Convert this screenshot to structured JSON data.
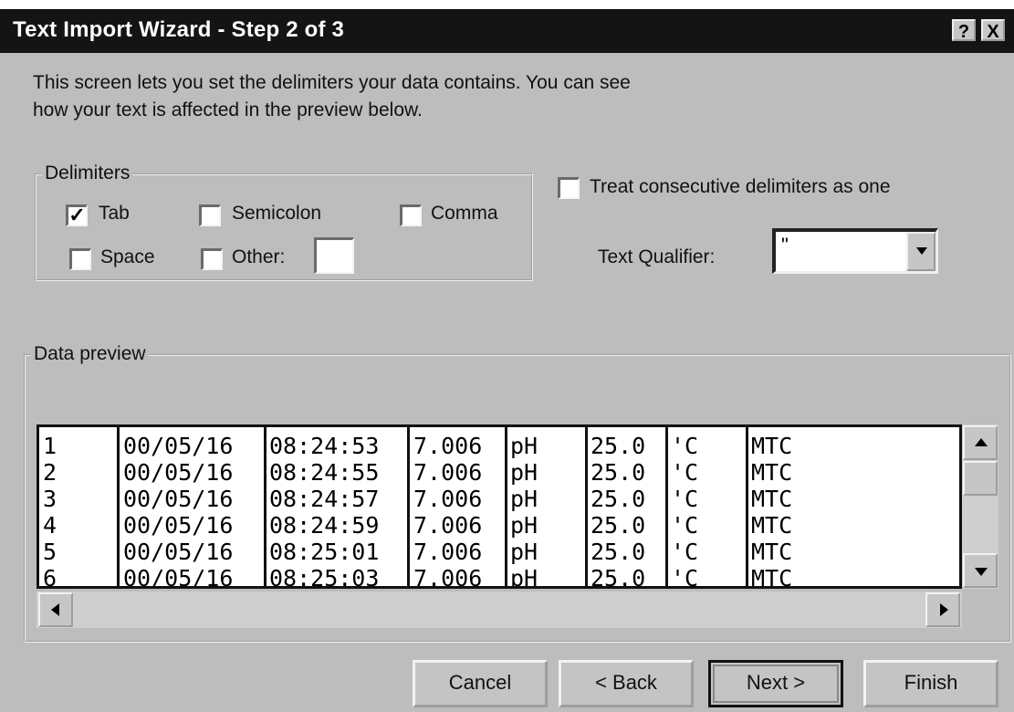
{
  "window": {
    "title": "Text Import Wizard - Step 2 of 3",
    "help_label": "?",
    "close_label": "X"
  },
  "intro": {
    "line1": "This screen lets you set the delimiters your data contains.  You can see",
    "line2": "how your text is affected in the preview below."
  },
  "delimiters": {
    "legend": "Delimiters",
    "options": [
      {
        "label": "Tab",
        "checked": true
      },
      {
        "label": "Semicolon",
        "checked": false
      },
      {
        "label": "Comma",
        "checked": false
      },
      {
        "label": "Space",
        "checked": false
      },
      {
        "label": "Other:",
        "checked": false
      }
    ],
    "other_value": ""
  },
  "consecutive": {
    "label": "Treat consecutive delimiters as one",
    "checked": false
  },
  "qualifier": {
    "label": "Text Qualifier:",
    "value": "\""
  },
  "preview": {
    "legend": "Data preview",
    "rows": [
      [
        "1",
        "00/05/16",
        "08:24:53",
        "7.006",
        "pH",
        "25.0",
        "'C",
        "MTC"
      ],
      [
        "2",
        "00/05/16",
        "08:24:55",
        "7.006",
        "pH",
        "25.0",
        "'C",
        "MTC"
      ],
      [
        "3",
        "00/05/16",
        "08:24:57",
        "7.006",
        "pH",
        "25.0",
        "'C",
        "MTC"
      ],
      [
        "4",
        "00/05/16",
        "08:24:59",
        "7.006",
        "pH",
        "25.0",
        "'C",
        "MTC"
      ],
      [
        "5",
        "00/05/16",
        "08:25:01",
        "7.006",
        "pH",
        "25.0",
        "'C",
        "MTC"
      ],
      [
        "6",
        "00/05/16",
        "08:25:03",
        "7.006",
        "pH",
        "25.0",
        "'C",
        "MTC"
      ]
    ]
  },
  "buttons": {
    "cancel": "Cancel",
    "back": "< Back",
    "next": "Next >",
    "finish": "Finish"
  },
  "colors": {
    "dialog_bg": "#bdbdbd",
    "titlebar_bg": "#141414"
  }
}
